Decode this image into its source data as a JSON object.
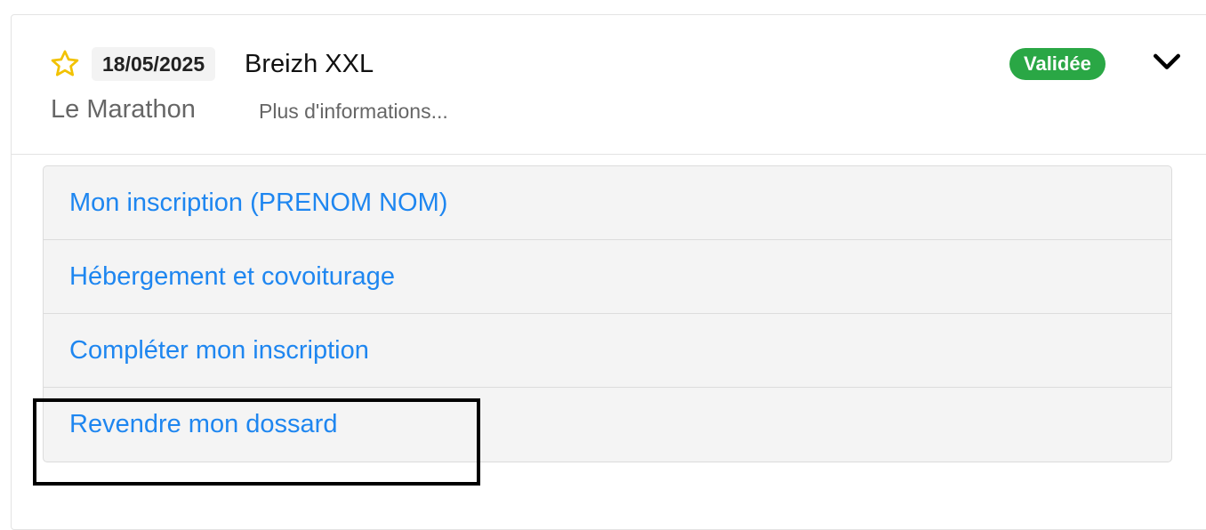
{
  "event": {
    "date": "18/05/2025",
    "title": "Breizh XXL",
    "race": "Le Marathon",
    "more_info": "Plus d'informations...",
    "status": "Validée",
    "status_color": "#2aa745",
    "favorite_icon": "star-outline-icon",
    "toggle_icon": "chevron-down-icon"
  },
  "menu": {
    "items": [
      {
        "label": "Mon inscription (PRENOM NOM)"
      },
      {
        "label": "Hébergement et covoiturage"
      },
      {
        "label": "Compléter mon inscription"
      },
      {
        "label": "Revendre mon dossard"
      }
    ],
    "link_color": "#1e86f0"
  }
}
